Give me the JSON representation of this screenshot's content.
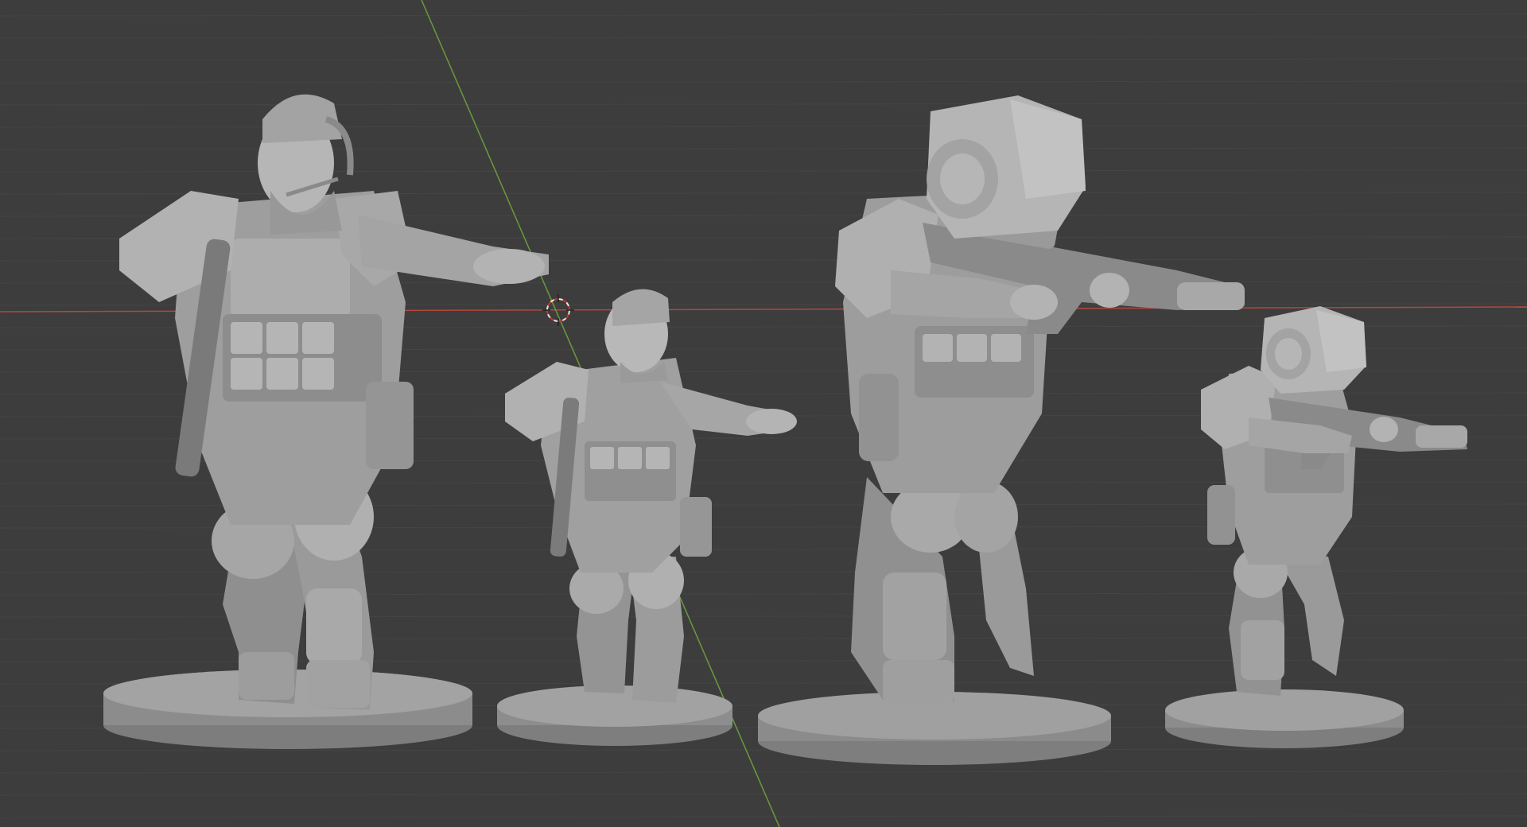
{
  "viewport": {
    "name": "3d-viewport",
    "background": "#3d3d3d",
    "grid_color": "#454545",
    "x_axis_color": "#b2473f",
    "y_axis_color": "#6b9a3a",
    "cursor_color": "#e8e8e8",
    "cursor_accent": "#c0392b",
    "model_color": "#9c9c9c",
    "model_highlight": "#c4c4c4",
    "model_shadow": "#6e6e6e",
    "base_color": "#8e8e8e",
    "base_edge": "#7a7a7a"
  },
  "objects": [
    {
      "name": "soldier-miniature-female-pointing",
      "icon": "miniature-figure"
    },
    {
      "name": "soldier-miniature-small-pointing",
      "icon": "miniature-figure"
    },
    {
      "name": "soldier-miniature-helmet-rifle",
      "icon": "miniature-figure"
    },
    {
      "name": "soldier-miniature-small-rifle",
      "icon": "miniature-figure"
    }
  ],
  "cursor_icon": "3d-cursor-icon"
}
